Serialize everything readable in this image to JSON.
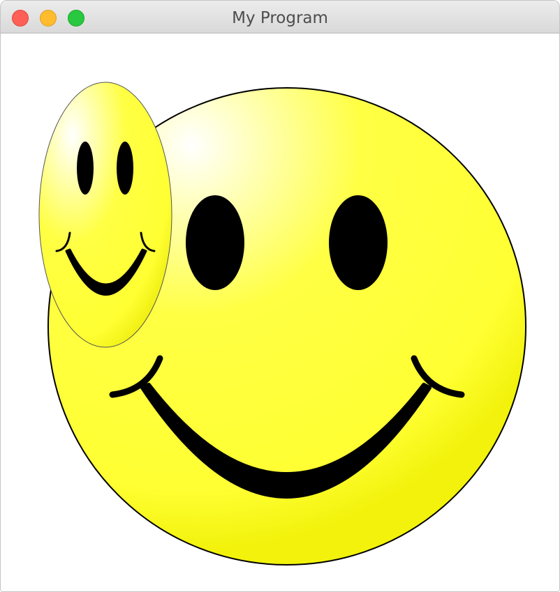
{
  "window": {
    "title": "My Program",
    "controls": {
      "close": "close-icon",
      "minimize": "minimize-icon",
      "zoom": "zoom-icon"
    }
  },
  "canvas": {
    "background": "#ffffff",
    "smiley_fill_highlight": "#ffffff",
    "smiley_fill_main": "#ffff33",
    "smiley_fill_edge": "#f0f000",
    "feature_color": "#000000"
  }
}
